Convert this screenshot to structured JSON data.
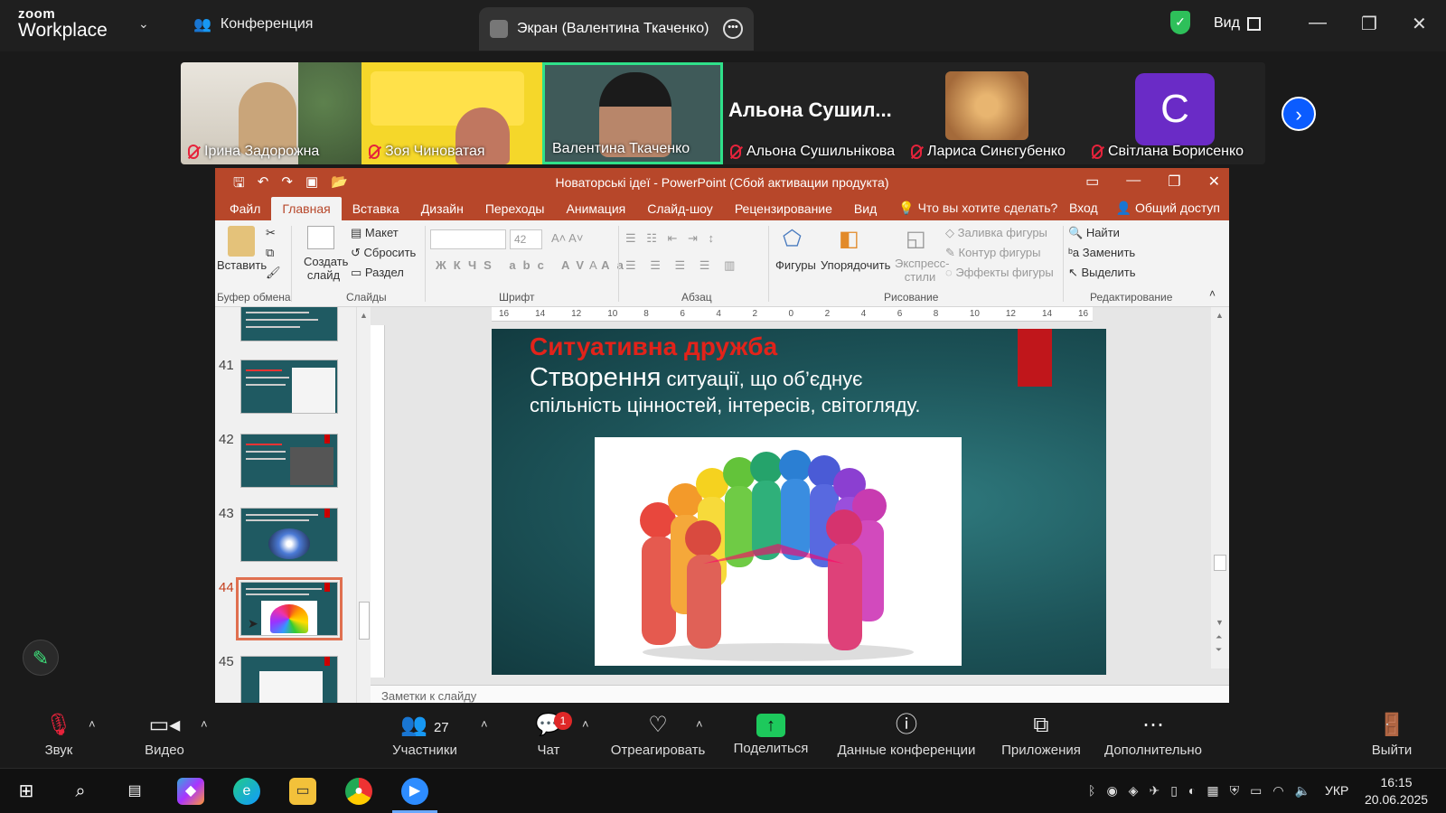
{
  "zoom": {
    "logo_line1": "zoom",
    "logo_line2": "Workplace",
    "conference_label": "Конференция",
    "screen_tab": "Экран (Валентина Ткаченко)",
    "view_label": "Вид"
  },
  "participants": [
    {
      "name": "Ірина Задорожна",
      "muted": true
    },
    {
      "name": "Зоя Чиноватая",
      "muted": true
    },
    {
      "name": "Валентина Ткаченко",
      "muted": false,
      "active": true
    },
    {
      "name": "Альона Сушильнікова",
      "muted": true,
      "big_label": "Альона  Сушил..."
    },
    {
      "name": "Лариса Синєгубенко",
      "muted": true
    },
    {
      "name": "Світлана Борисенко",
      "muted": true,
      "initial": "С"
    }
  ],
  "ppt": {
    "title": "Новаторські ідеї - PowerPoint (Сбой активации продукта)",
    "tabs": [
      "Файл",
      "Главная",
      "Вставка",
      "Дизайн",
      "Переходы",
      "Анимация",
      "Слайд-шоу",
      "Рецензирование",
      "Вид"
    ],
    "active_tab": "Главная",
    "tell_me": "Что вы хотите сделать?",
    "sign_in": "Вход",
    "share": "Общий доступ",
    "ribbon": {
      "paste": "Вставить",
      "clipboard_group": "Буфер обмена",
      "new_slide": "Создать слайд",
      "layout": "Макет",
      "reset": "Сбросить",
      "section": "Раздел",
      "slides_group": "Слайды",
      "font_size": "42",
      "font_group": "Шрифт",
      "paragraph_group": "Абзац",
      "shapes": "Фигуры",
      "arrange": "Упорядочить",
      "quick_styles": "Экспресс-стили",
      "shape_fill": "Заливка фигуры",
      "shape_outline": "Контур фигуры",
      "shape_effects": "Эффекты фигуры",
      "drawing_group": "Рисование",
      "find": "Найти",
      "replace": "Заменить",
      "select": "Выделить",
      "editing_group": "Редактирование"
    },
    "thumbnails": [
      {
        "num": "41"
      },
      {
        "num": "42"
      },
      {
        "num": "43"
      },
      {
        "num": "44",
        "selected": true
      },
      {
        "num": "45"
      }
    ],
    "ruler_ticks": [
      "16",
      "14",
      "12",
      "10",
      "8",
      "6",
      "4",
      "2",
      "0",
      "2",
      "4",
      "6",
      "8",
      "10",
      "12",
      "14",
      "16"
    ],
    "slide": {
      "title": "Ситуативна дружба",
      "line1_big": "Створення",
      "line1_rest": " ситуації, що об’єднує",
      "line2": "спільність цінностей, інтересів, світогляду."
    },
    "notes": "Заметки к слайду"
  },
  "controls": {
    "audio": "Звук",
    "video": "Видео",
    "participants": "Участники",
    "participants_count": "27",
    "chat": "Чат",
    "chat_badge": "1",
    "react": "Отреагировать",
    "share": "Поделиться",
    "conference_info": "Данные конференции",
    "apps": "Приложения",
    "more": "Дополнительно",
    "leave": "Выйти"
  },
  "taskbar": {
    "lang": "УКР",
    "time": "16:15",
    "date": "20.06.2025"
  },
  "colors": {
    "ppt_accent": "#b7472a",
    "zoom_share": "#1dc95c",
    "zoom_blue": "#0b5cff",
    "slide_title_red": "#e2231a"
  }
}
